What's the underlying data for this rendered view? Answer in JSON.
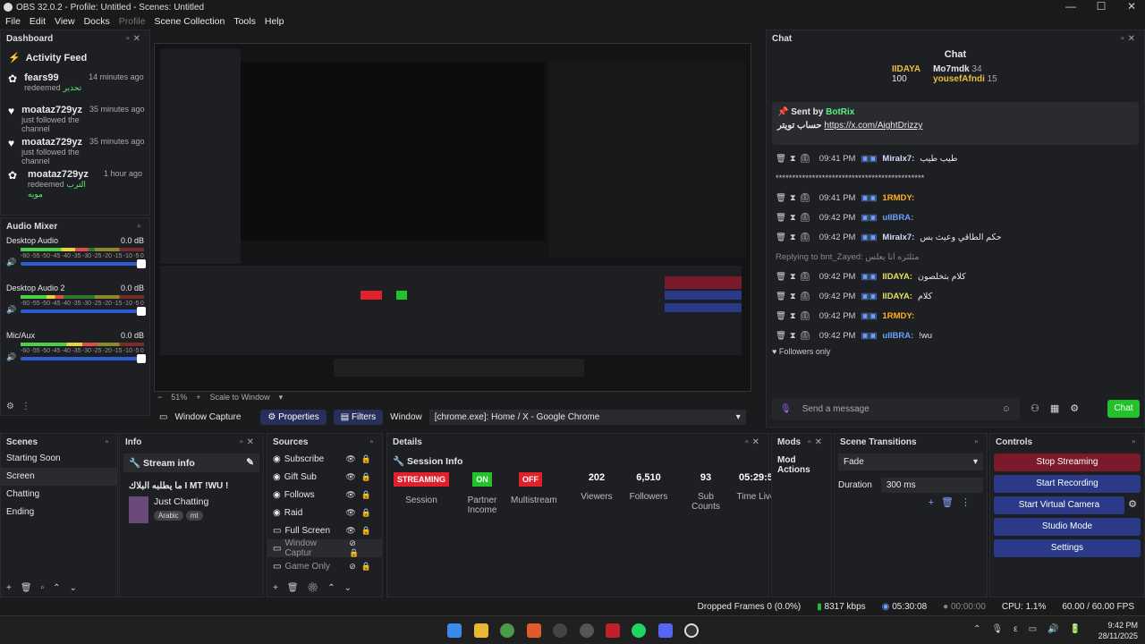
{
  "window": {
    "title": "OBS 32.0.2 - Profile: Untitled - Scenes: Untitled",
    "min": "—",
    "max": "☐",
    "close": "✕"
  },
  "menu": [
    "File",
    "Edit",
    "View",
    "Docks",
    "Profile",
    "Scene Collection",
    "Tools",
    "Help"
  ],
  "dashboard": {
    "title": "Dashboard",
    "feed_title": "Activity Feed",
    "items": [
      {
        "name": "fears99",
        "sub": "redeemed",
        "extra": "تحذير",
        "time": "14 minutes ago"
      },
      {
        "name": "moataz729yz",
        "sub": "just followed the channel",
        "extra": "",
        "time": "35 minutes ago"
      },
      {
        "name": "moataz729yz",
        "sub": "just followed the channel",
        "extra": "",
        "time": "35 minutes ago"
      },
      {
        "name": "moataz729yz",
        "sub": "redeemed",
        "extra": "الترب مويه",
        "time": "1 hour ago"
      }
    ]
  },
  "mixer": {
    "title": "Audio Mixer",
    "ticks": [
      "-60",
      "-55",
      "-50",
      "-45",
      "-40",
      "-35",
      "-30",
      "-25",
      "-20",
      "-15",
      "-10",
      "-5",
      "0"
    ],
    "channels": [
      {
        "name": "Desktop Audio",
        "db": "0.0 dB",
        "level": 0.55
      },
      {
        "name": "Desktop Audio 2",
        "db": "0.0 dB",
        "level": 0.35
      },
      {
        "name": "Mic/Aux",
        "db": "0.0 dB",
        "level": 0.62
      }
    ]
  },
  "preview": {
    "zoom": "51%",
    "scale": "Scale to Window"
  },
  "source_bar": {
    "source": "Window Capture",
    "properties": "Properties",
    "filters": "Filters",
    "window_label": "Window",
    "window_value": "[chrome.exe]: Home / X - Google Chrome"
  },
  "chat": {
    "dock_title": "Chat",
    "header": "Chat",
    "top": [
      {
        "name": "IIDAYA",
        "count": "100"
      },
      {
        "name": "Mo7mdk",
        "count": "34"
      },
      {
        "name": "yousefAfndi",
        "count": "15"
      }
    ],
    "pinned": {
      "sent_by": "Sent by",
      "bot": "BotRix",
      "text": "حساب تويتر",
      "link": "https://x.com/AightDrizzy"
    },
    "lines": [
      {
        "time": "09:41 PM",
        "user": "Miralx7:",
        "msg": "طيب طيب",
        "color": "#d9d9ff"
      },
      {
        "time": "",
        "user": "",
        "msg": "*********************************************",
        "color": "#ccc"
      },
      {
        "time": "09:41 PM",
        "user": "1RMDY:",
        "msg": "",
        "color": "#ffb020"
      },
      {
        "time": "09:42 PM",
        "user": "uIIBRA:",
        "msg": "",
        "color": "#6aa0ff"
      },
      {
        "time": "09:42 PM",
        "user": "Miralx7:",
        "msg": "حكم الطاقي وعيث بس",
        "color": "#d9d9ff"
      },
      {
        "time": "",
        "user": "",
        "msg": "Replying to bnt_Zayed: مثلثره انا يعلس",
        "color": "#888"
      },
      {
        "time": "09:42 PM",
        "user": "IIDAYA:",
        "msg": "كلام بتخلصون",
        "color": "#e8e060"
      },
      {
        "time": "09:42 PM",
        "user": "IIDAYA:",
        "msg": "كلام",
        "color": "#e8e060"
      },
      {
        "time": "09:42 PM",
        "user": "1RMDY:",
        "msg": "",
        "color": "#ffb020"
      },
      {
        "time": "09:42 PM",
        "user": "uIIBRA:",
        "msg": "!wu",
        "color": "#6aa0ff"
      }
    ],
    "followers_only": "Followers only",
    "placeholder": "Send a message",
    "send": "Chat"
  },
  "scenes": {
    "title": "Scenes",
    "items": [
      "Starting Soon",
      "Screen",
      "Chatting",
      "Ending"
    ],
    "selected": 1
  },
  "info": {
    "title": "Info",
    "stream_info": "Stream info",
    "stream_title": "ما يطلبه البلاك I MT !WU !",
    "category": "Just Chatting",
    "tags": [
      "Arabic",
      "mt"
    ]
  },
  "sources": {
    "title": "Sources",
    "items": [
      "Subscribe",
      "Gift Sub",
      "Follows",
      "Raid",
      "Full Screen",
      "Window Captur",
      "Game Only"
    ]
  },
  "details": {
    "title": "Details",
    "session_info": "Session Info",
    "stats": [
      {
        "value": "STREAMING",
        "label": "Session",
        "badge": "#e0202a"
      },
      {
        "value": "ON",
        "label": "Partner Income",
        "badge": "#22c22a"
      },
      {
        "value": "OFF",
        "label": "Multistream",
        "badge": "#e0202a"
      },
      {
        "value": "202",
        "label": "Viewers"
      },
      {
        "value": "6,510",
        "label": "Followers"
      },
      {
        "value": "93",
        "label": "Sub Counts"
      },
      {
        "value": "05:29:5",
        "label": "Time Live"
      }
    ]
  },
  "mods": {
    "title": "Mods",
    "item": "Mod Actions"
  },
  "transitions": {
    "title": "Scene Transitions",
    "type": "Fade",
    "duration_label": "Duration",
    "duration": "300 ms"
  },
  "controls": {
    "title": "Controls",
    "buttons": [
      "Stop Streaming",
      "Start Recording",
      "Start Virtual Camera",
      "Studio Mode",
      "Settings"
    ]
  },
  "status": {
    "dropped": "Dropped Frames 0 (0.0%)",
    "kbps": "8317 kbps",
    "live": "05:30:08",
    "rec": "00:00:00",
    "cpu": "CPU: 1.1%",
    "fps": "60.00 / 60.00 FPS"
  },
  "taskbar": {
    "time": "9:42 PM",
    "date": "28/11/2025"
  }
}
